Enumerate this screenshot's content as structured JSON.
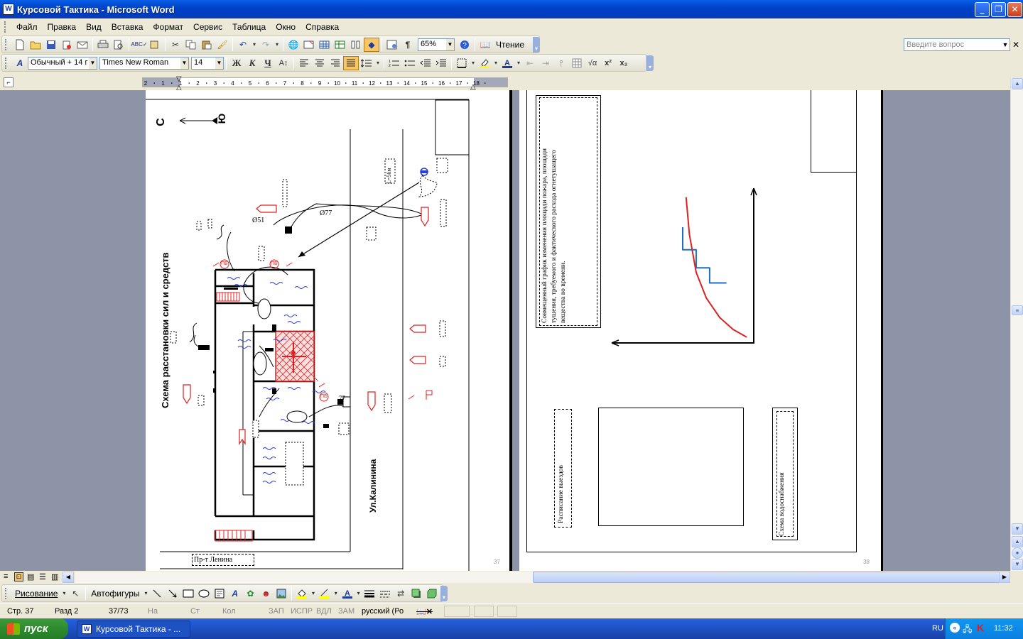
{
  "window": {
    "title": "Курсовой Тактика - Microsoft Word",
    "app_icon": "word-icon"
  },
  "menu": {
    "items": [
      "Файл",
      "Правка",
      "Вид",
      "Вставка",
      "Формат",
      "Сервис",
      "Таблица",
      "Окно",
      "Справка"
    ],
    "ask_placeholder": "Введите вопрос"
  },
  "standard_toolbar": {
    "zoom": "65%",
    "reading_label": "Чтение"
  },
  "formatting_toolbar": {
    "style": "Обычный + 14 г",
    "font": "Times New Roman",
    "size": "14"
  },
  "ruler": {
    "labels": [
      "2",
      "1",
      "1",
      "2",
      "3",
      "4",
      "5",
      "6",
      "7",
      "8",
      "9",
      "10",
      "11",
      "12",
      "13",
      "14",
      "15",
      "16",
      "17",
      "18"
    ]
  },
  "left_page": {
    "north_label": "С",
    "south_label": "Ю",
    "scheme_title": "Схема расстановки сил и средств",
    "street_label": "Ул.Калинина",
    "avenue_label": "Пр-т Ленина",
    "distance_label": "L=56м",
    "hydrant_1": "Ø51",
    "hydrant_2": "Ø77",
    "hydrant_3": "77",
    "pb_label": "ПБ",
    "page_number": "37"
  },
  "right_page": {
    "chart_caption": "Совмещенный график изменения площади пожара, площади тушения, требуемого и фактического расхода огнетушащего вещества во времени.",
    "schedule_label": "Расписание выездов",
    "water_supply_label": "Схема водоснабжения",
    "page_number": "38"
  },
  "drawing_toolbar": {
    "drawing_label": "Рисование",
    "autoshapes_label": "Автофигуры"
  },
  "status": {
    "page": "Стр.  37",
    "section": "Разд  2",
    "pages": "37/73",
    "at": "На",
    "line": "Ст",
    "col": "Кол",
    "rec": "ЗАП",
    "trk": "ИСПР",
    "ext": "ВДЛ",
    "ovr": "ЗАМ",
    "language": "русский (Ро"
  },
  "taskbar": {
    "start_label": "пуск",
    "task_label": "Курсовой Тактика - ...",
    "lang": "RU",
    "clock": "11:32"
  },
  "colors": {
    "fire_red": "#e02020",
    "hose_blue": "#1f6fbf",
    "water_blue": "#2a3ed8",
    "doc_background": "#8d94a8"
  },
  "chart_data": {
    "type": "line",
    "title": "",
    "xlabel": "",
    "ylabel": "",
    "series": [
      {
        "values": [
          [
            0.0,
            0.95
          ],
          [
            0.05,
            0.7
          ],
          [
            0.15,
            0.45
          ],
          [
            0.3,
            0.28
          ],
          [
            0.5,
            0.15
          ],
          [
            0.7,
            0.07
          ],
          [
            0.9,
            0.02
          ]
        ]
      },
      {
        "values": [
          [
            -0.05,
            0.75
          ],
          [
            -0.05,
            0.6
          ],
          [
            0.15,
            0.6
          ],
          [
            0.15,
            0.48
          ],
          [
            0.35,
            0.48
          ],
          [
            0.35,
            0.38
          ],
          [
            0.6,
            0.38
          ]
        ]
      }
    ]
  }
}
